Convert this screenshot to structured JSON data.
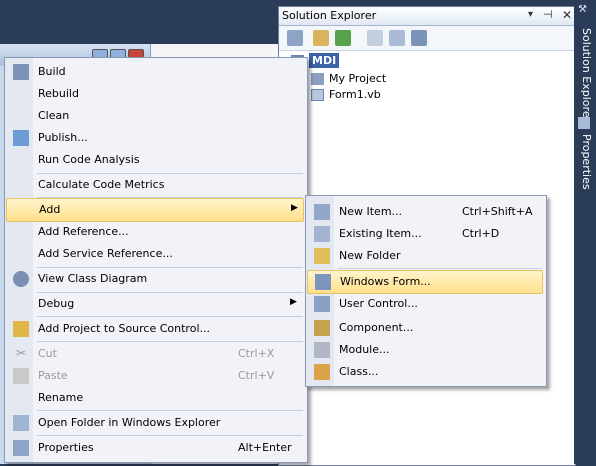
{
  "solution_explorer": {
    "title": "Solution Explorer",
    "pin_glyph": "▾",
    "autohide_glyph": "⊣",
    "close_glyph": "✕",
    "tree": [
      {
        "label": "MDI",
        "selected": true
      },
      {
        "label": "My Project"
      },
      {
        "label": "Form1.vb"
      }
    ]
  },
  "dock_tabs": [
    "Solution Explorer",
    "Properties"
  ],
  "context_menu": {
    "items": [
      {
        "label": "Build"
      },
      {
        "label": "Rebuild"
      },
      {
        "label": "Clean"
      },
      {
        "label": "Publish..."
      },
      {
        "label": "Run Code Analysis"
      },
      {
        "label": "Calculate Code Metrics"
      },
      {
        "label": "Add"
      },
      {
        "label": "Add Reference..."
      },
      {
        "label": "Add Service Reference..."
      },
      {
        "label": "View Class Diagram"
      },
      {
        "label": "Debug"
      },
      {
        "label": "Add Project to Source Control..."
      },
      {
        "label": "Cut",
        "shortcut": "Ctrl+X"
      },
      {
        "label": "Paste",
        "shortcut": "Ctrl+V"
      },
      {
        "label": "Rename"
      },
      {
        "label": "Open Folder in Windows Explorer"
      },
      {
        "label": "Properties",
        "shortcut": "Alt+Enter"
      }
    ]
  },
  "submenu": {
    "items": [
      {
        "label": "New Item...",
        "shortcut": "Ctrl+Shift+A"
      },
      {
        "label": "Existing Item...",
        "shortcut": "Ctrl+D"
      },
      {
        "label": "New Folder"
      },
      {
        "label": "Windows Form..."
      },
      {
        "label": "User Control..."
      },
      {
        "label": "Component..."
      },
      {
        "label": "Module..."
      },
      {
        "label": "Class..."
      }
    ]
  },
  "colors": {
    "accent": "#2b3c59",
    "highlight": "#ffe08a",
    "menu_bg": "#f1f3f8"
  }
}
